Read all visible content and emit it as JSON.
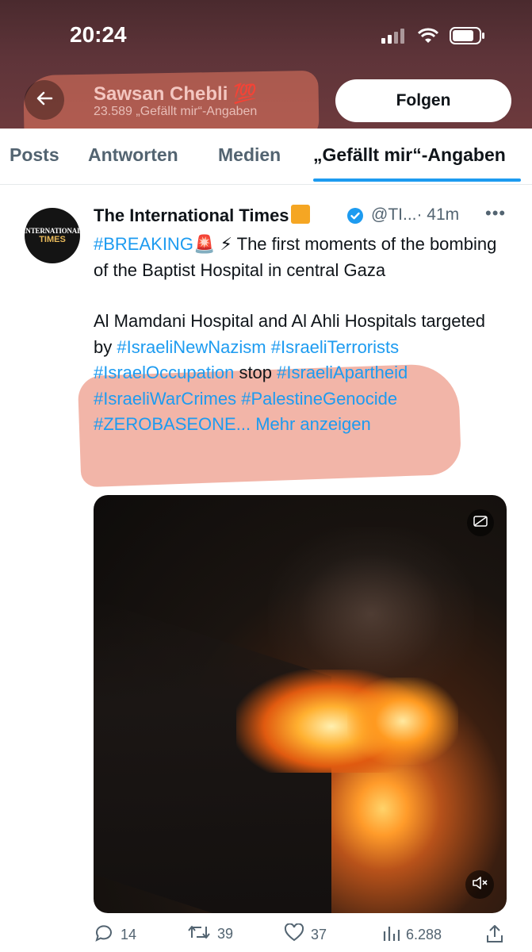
{
  "status_bar": {
    "time": "20:24"
  },
  "profile": {
    "name": "Sawsan Chebli",
    "name_emoji": "💯",
    "subtitle": "23.589 „Gefällt mir“-Angaben",
    "follow_label": "Folgen"
  },
  "tabs": [
    {
      "label": "Posts",
      "active": false
    },
    {
      "label": "Antworten",
      "active": false
    },
    {
      "label": "Medien",
      "active": false
    },
    {
      "label": "„Gefällt mir“-Angaben",
      "active": true
    }
  ],
  "tweet": {
    "avatar_text": {
      "line1": "INTERNATIONAL",
      "line2": "TIMES"
    },
    "author_name": "The International Times",
    "handle": "@TI...",
    "time": "· 41m",
    "more": "•••",
    "text": {
      "line1_tag": "#BREAKING",
      "line1_emoji": "🚨",
      "line1_rest": "⚡ The first moments of the bombing of the Baptist Hospital in central Gaza",
      "para2_intro": "Al Mamdani Hospital and Al Ahli Hospitals targeted by ",
      "tag1": "#IsraeliNewNazism",
      "tag2": "#IsraeliTerrorists",
      "tag3": "#IsraelOccupation",
      "stop_word": " stop ",
      "tag4": "#IsraeliApartheid",
      "tag5": "#IsraeliWarCrimes",
      "tag6": "#PalestineGenocide",
      "tag7": "#ZEROBASEONE...",
      "more_link": "Mehr anzeigen"
    },
    "actions": {
      "replies": "14",
      "reposts": "39",
      "likes": "37",
      "views": "6.288"
    }
  },
  "icons": [
    "back-arrow-icon",
    "signal-icon",
    "wifi-icon",
    "battery-icon",
    "verified-icon",
    "closed-captions-icon",
    "mute-icon",
    "reply-icon",
    "repost-icon",
    "like-icon",
    "views-icon",
    "share-icon"
  ],
  "colors": {
    "accent": "#1d9bf0",
    "header_bg": "#5e3439",
    "highlight": "#e87860"
  }
}
